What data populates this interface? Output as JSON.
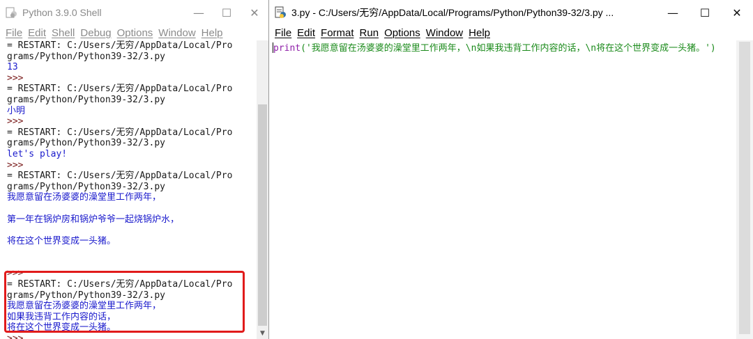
{
  "shell": {
    "title": "Python 3.9.0 Shell",
    "controls": {
      "minimize": "—",
      "maximize": "☐",
      "close": "✕"
    },
    "menu": [
      "File",
      "Edit",
      "Shell",
      "Debug",
      "Options",
      "Window",
      "Help"
    ],
    "lines": [
      {
        "text": "= RESTART: C:/Users/无穷/AppData/Local/Pro",
        "kind": "restart"
      },
      {
        "text": "grams/Python/Python39-32/3.py",
        "kind": "restart"
      },
      {
        "text": "13",
        "kind": "out"
      },
      {
        "text": ">>>",
        "kind": "prompt"
      },
      {
        "text": "= RESTART: C:/Users/无穷/AppData/Local/Pro",
        "kind": "restart"
      },
      {
        "text": "grams/Python/Python39-32/3.py",
        "kind": "restart"
      },
      {
        "text": "小明",
        "kind": "out"
      },
      {
        "text": ">>>",
        "kind": "prompt"
      },
      {
        "text": "= RESTART: C:/Users/无穷/AppData/Local/Pro",
        "kind": "restart"
      },
      {
        "text": "grams/Python/Python39-32/3.py",
        "kind": "restart"
      },
      {
        "text": "let's play!",
        "kind": "out"
      },
      {
        "text": ">>>",
        "kind": "prompt"
      },
      {
        "text": "= RESTART: C:/Users/无穷/AppData/Local/Pro",
        "kind": "restart"
      },
      {
        "text": "grams/Python/Python39-32/3.py",
        "kind": "restart"
      },
      {
        "text": "我愿意留在汤婆婆的澡堂里工作两年，",
        "kind": "out"
      },
      {
        "text": "",
        "kind": "blank"
      },
      {
        "text": "第一年在锅炉房和锅炉爷爷一起烧锅炉水，",
        "kind": "out"
      },
      {
        "text": "",
        "kind": "blank"
      },
      {
        "text": "将在这个世界变成一头猪。",
        "kind": "out"
      },
      {
        "text": "",
        "kind": "blank"
      },
      {
        "text": "",
        "kind": "blank"
      },
      {
        "text": ">>>",
        "kind": "prompt"
      },
      {
        "text": "= RESTART: C:/Users/无穷/AppData/Local/Pro",
        "kind": "restart"
      },
      {
        "text": "grams/Python/Python39-32/3.py",
        "kind": "restart"
      },
      {
        "text": "我愿意留在汤婆婆的澡堂里工作两年，",
        "kind": "out"
      },
      {
        "text": "如果我违背工作内容的话，",
        "kind": "out"
      },
      {
        "text": "将在这个世界变成一头猪。",
        "kind": "out"
      },
      {
        "text": ">>>",
        "kind": "prompt"
      }
    ]
  },
  "editor": {
    "title": "3.py - C:/Users/无穷/AppData/Local/Programs/Python/Python39-32/3.py ...",
    "controls": {
      "minimize": "—",
      "maximize": "☐",
      "close": "✕"
    },
    "menu": [
      "File",
      "Edit",
      "Format",
      "Run",
      "Options",
      "Window",
      "Help"
    ],
    "code": {
      "keyword": "print",
      "rest": "('我愿意留在汤婆婆的澡堂里工作两年，\\n如果我违背工作内容的话，\\n将在这个世界变成一头猪。')"
    }
  },
  "colors": {
    "prompt": "#771717",
    "output": "#1a1acc",
    "keyword": "#8e1ea8",
    "string": "#1a8a1a",
    "highlight": "#e11b1b"
  }
}
